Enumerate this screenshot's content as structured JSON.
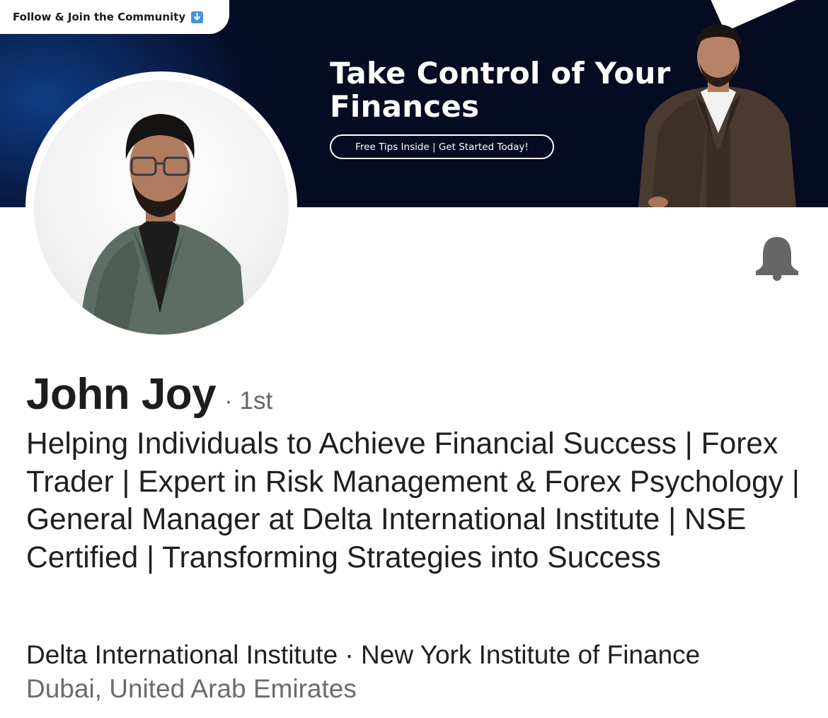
{
  "banner": {
    "follow_text": "Follow & Join the Community",
    "follow_icon": "down-arrow-icon",
    "title_line1": "Take Control of Your",
    "title_line2": "Finances",
    "cta_text": "Free Tips Inside |  Get Started Today!",
    "colors": {
      "background": "#050b20",
      "accent": "#0e3d86",
      "badge": "#4a90e2"
    }
  },
  "profile": {
    "name": "John Joy",
    "degree": "· 1st",
    "headline": "Helping Individuals to Achieve Financial Success | Forex Trader | Expert in Risk Management & Forex Psychology | General Manager at Delta International Institute | NSE Certified | Transforming Strategies into Success",
    "education": "Delta International Institute · New York Institute of Finance",
    "location": "Dubai, United Arab Emirates"
  },
  "actions": {
    "notify_icon": "bell-icon"
  }
}
